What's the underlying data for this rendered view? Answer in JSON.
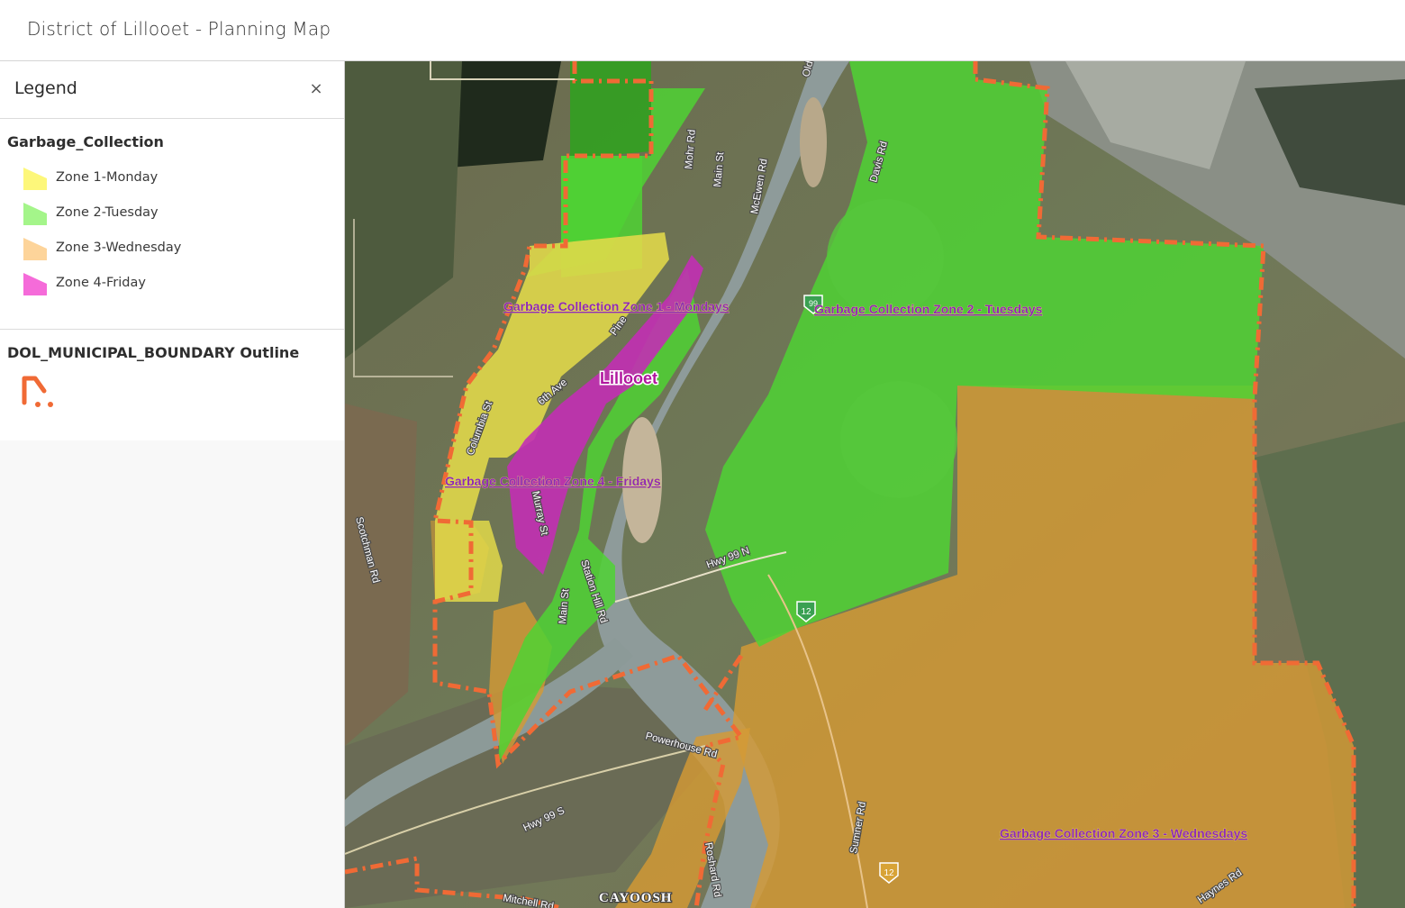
{
  "app": {
    "title": "District of Lillooet - Planning Map"
  },
  "legend": {
    "title": "Legend",
    "close_label": "×",
    "layers": [
      {
        "name": "Garbage_Collection",
        "items": [
          {
            "label": "Zone 1-Monday",
            "color": "#fdf77a",
            "icon": "polygon-swatch"
          },
          {
            "label": "Zone 2-Tuesday",
            "color": "#a4f58a",
            "icon": "polygon-swatch"
          },
          {
            "label": "Zone 3-Wednesday",
            "color": "#fdd49a",
            "icon": "polygon-swatch"
          },
          {
            "label": "Zone 4-Friday",
            "color": "#f56bd9",
            "icon": "polygon-swatch"
          }
        ]
      },
      {
        "name": "DOL_MUNICIPAL_BOUNDARY Outline",
        "items": [
          {
            "label": "",
            "color": "#f06a35",
            "icon": "dashed-outline-swatch"
          }
        ]
      }
    ]
  },
  "map": {
    "zone_labels": {
      "zone1": "Garbage Collection Zone 1 - Mondays",
      "zone2": "Garbage Collection Zone 2 - Tuesdays",
      "zone3": "Garbage Collection Zone 3 - Wednesdays",
      "zone4": "Garbage Collection Zone 4 - Fridays"
    },
    "place_labels": {
      "town": "Lillooet",
      "cayoosh": "CAYOOSH"
    },
    "road_labels": {
      "mohr": "Mohr Rd",
      "main_n": "Main St",
      "mcewen": "McEwen Rd",
      "davis": "Davis Rd",
      "old": "Old",
      "pine": "Pine",
      "sixth": "6th Ave",
      "columbia": "Columbia St",
      "murray": "Murray St",
      "main_s": "Main St",
      "station": "Station Hill Rd",
      "hwy99n": "Hwy 99 N",
      "scotchman": "Scotchman Rd",
      "powerhouse": "Powerhouse Rd",
      "hwy99s": "Hwy 99 S",
      "mitchell": "Mitchell Rd",
      "roshard": "Roshard Rd",
      "sumner": "Sumner Rd",
      "haynes": "Haynes Rd"
    },
    "shields": {
      "s99": "99",
      "s12a": "12",
      "s12b": "12"
    },
    "colors": {
      "zone1": "#e2d94a",
      "zone2": "#4fd234",
      "zone3": "#d49a34",
      "zone4": "#c22fb4",
      "boundary": "#f06a35",
      "river": "#8e9b9a"
    }
  }
}
